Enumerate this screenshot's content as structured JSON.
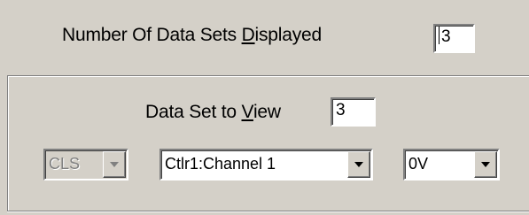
{
  "top": {
    "label_pre": "Number Of Data Sets ",
    "label_accel": "D",
    "label_post": "isplayed",
    "value": "3"
  },
  "group": {
    "label_pre": "Data Set to ",
    "label_accel": "V",
    "label_post": "iew",
    "value": "3"
  },
  "combos": {
    "cls": {
      "value": "CLS",
      "enabled": false
    },
    "channel": {
      "value": "Ctlr1:Channel 1",
      "enabled": true
    },
    "offset": {
      "value": "0V",
      "enabled": true
    }
  }
}
